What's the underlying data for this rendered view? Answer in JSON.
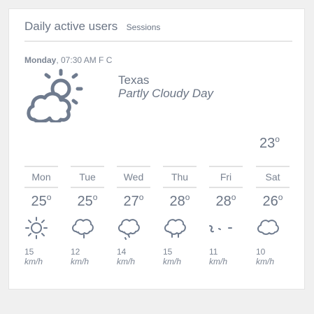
{
  "header": {
    "title": "Daily active users",
    "subtitle": "Sessions"
  },
  "current": {
    "day": "Monday",
    "time": ", 07:30 AM F C",
    "location": "Texas",
    "condition": "Partly Cloudy Day",
    "temp": "23",
    "icon": "partly-cloudy-icon"
  },
  "forecast": [
    {
      "day": "Mon",
      "temp": "25",
      "icon": "sun-icon",
      "wind": "15",
      "unit": "km/h"
    },
    {
      "day": "Tue",
      "temp": "25",
      "icon": "cloud-icon",
      "wind": "12",
      "unit": "km/h"
    },
    {
      "day": "Wed",
      "temp": "27",
      "icon": "cloud-drizzle-icon",
      "wind": "14",
      "unit": "km/h"
    },
    {
      "day": "Thu",
      "temp": "28",
      "icon": "cloud-rain-icon",
      "wind": "15",
      "unit": "km/h"
    },
    {
      "day": "Fri",
      "temp": "28",
      "icon": "wind-icon",
      "wind": "11",
      "unit": "km/h"
    },
    {
      "day": "Sat",
      "temp": "26",
      "icon": "cloud-icon",
      "wind": "10",
      "unit": "km/h"
    }
  ],
  "colors": {
    "icon": "#6f7b8e",
    "text": "#6b7585"
  }
}
